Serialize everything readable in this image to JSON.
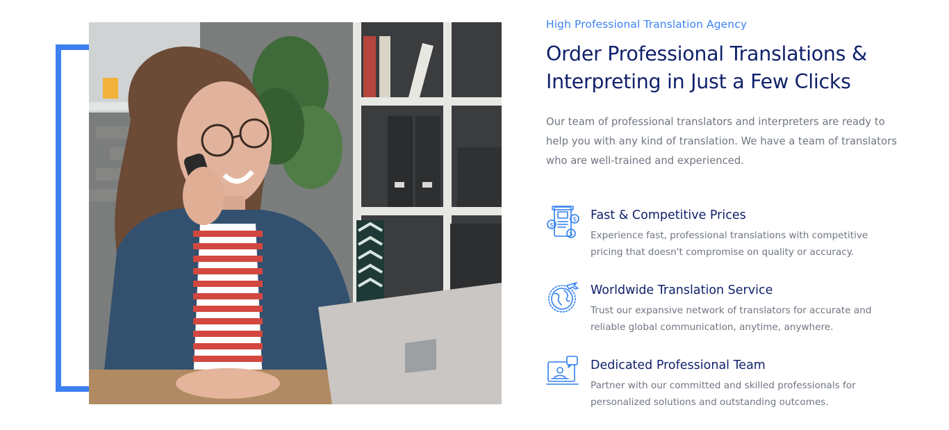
{
  "colors": {
    "accent": "#3d80f2",
    "heading": "#10216a",
    "body_text": "#6f7581",
    "eyebrow": "#3b82f6"
  },
  "hero": {
    "image_alt": "Woman on phone call smiling at laptop in office",
    "eyebrow": "High Professional Translation Agency",
    "headline": "Order Professional Translations & Interpreting in Just a Few Clicks",
    "description": "Our team of professional translators and interpreters are ready to help you with any kind of translation. We have a team of translators who are well-trained and experienced."
  },
  "features": [
    {
      "icon": "price-document-icon",
      "title": "Fast & Competitive Prices",
      "description": "Experience fast, professional translations with competitive pricing that doesn't compromise on quality or accuracy."
    },
    {
      "icon": "globe-plane-icon",
      "title": "Worldwide Translation Service",
      "description": "Trust our expansive network of translators for accurate and reliable global communication, anytime, anywhere."
    },
    {
      "icon": "professional-team-icon",
      "title": "Dedicated Professional Team",
      "description": "Partner with our committed and skilled professionals for personalized solutions and outstanding outcomes."
    }
  ]
}
